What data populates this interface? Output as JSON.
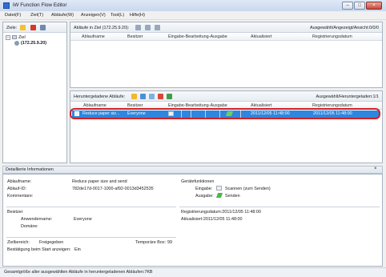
{
  "window": {
    "title": "iW Function Flow Editor"
  },
  "menu": [
    "Datei(F)",
    "Ziel(T)",
    "Abläufe(W)",
    "Anzeigen(V)",
    "Tool(L)",
    "Hilfe(H)"
  ],
  "targets": {
    "label": "Ziele:",
    "tree_root": "Ziel",
    "tree_child": "(172.25.9.20)"
  },
  "flows_in_target": {
    "title": "Abläufe in Ziel (172.25.9.20):",
    "status": "Ausgewählt/Angezeigt/Ansicht:0/0/0",
    "columns": [
      "Ablaufname",
      "Besitzer",
      "Eingabe-Bearbeitung-Ausgabe",
      "Aktualisiert",
      "Registrierungsdatum"
    ]
  },
  "downloaded_flows": {
    "title": "Heruntergeladene Abläufe:",
    "status": "Ausgewählt/Heruntergeladen:1/1",
    "columns": [
      "Ablaufname",
      "Besitzer",
      "Eingabe-Bearbeitung-Ausgabe",
      "Aktualisiert",
      "Registrierungsdatum"
    ],
    "rows": [
      {
        "name": "Reduce paper siz...",
        "owner": "Everyone",
        "updated": "2011/12/05 11:48:00",
        "registered": "2011/12/05 11:48:00"
      }
    ]
  },
  "details": {
    "header": "Detaillierte Informationen",
    "close": "×",
    "flow_name_label": "Ablaufname:",
    "flow_name": "Reduce paper size and send",
    "flow_id_label": "Ablauf-ID:",
    "flow_id": "782de17d-0017-1000-af92-0013d3452535",
    "comments_label": "Kommentare:",
    "device_functions_label": "Gerätefunktionen",
    "input_label": "Eingabe:",
    "input_value": "Scannen (zum Senden)",
    "output_label": "Ausgabe:",
    "output_value": "Senden",
    "owner_section": "Besitzer",
    "user_name_label": "Anwendername:",
    "user_name": "Everyone",
    "domain_label": "Domäne:",
    "registered_line": "Registrierungsdatum:2011/12/05 11:48:00",
    "updated_line": "Aktualisiert:2011/12/05 11:48:00",
    "target_area_label": "Zielbereich:",
    "target_area_value": "Freigegeben",
    "temp_box_label": "Temporäre Box:",
    "temp_box_value": "99",
    "confirm_label": "Bestätigung beim Start anzeigen:",
    "confirm_value": "Ein"
  },
  "statusbar": {
    "text": "Gesamtgröße aller ausgewählten Abläufe in heruntergeladenen Abläufen:7KB"
  },
  "colors": {
    "selection": "#2f86de",
    "highlight_border": "#d62020"
  }
}
